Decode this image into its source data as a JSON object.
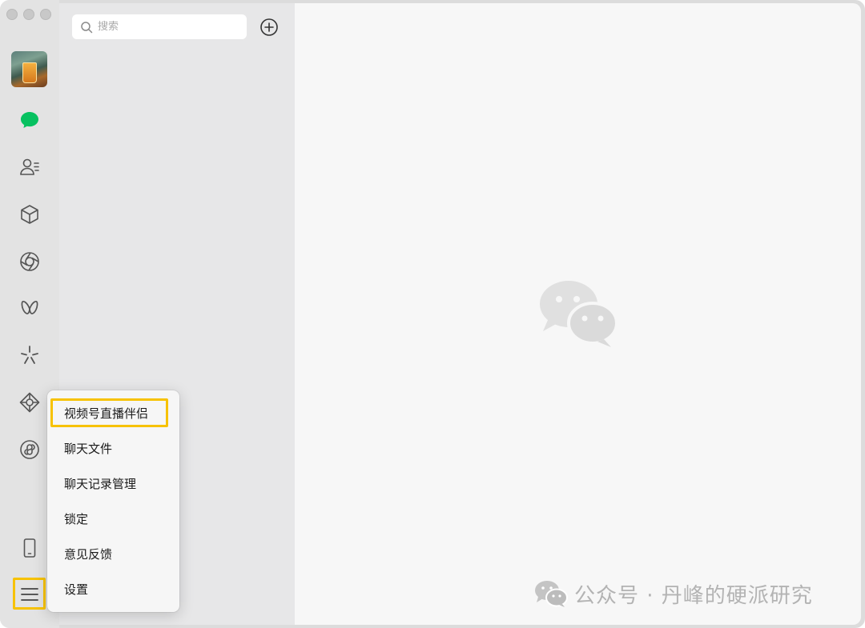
{
  "window": {
    "traffic_lights": [
      "close",
      "minimize",
      "zoom"
    ]
  },
  "sidebar": {
    "nav": [
      {
        "icon": "chat-bubble-icon",
        "label": "chats",
        "active": true
      },
      {
        "icon": "contacts-icon",
        "label": "contacts"
      },
      {
        "icon": "cube-icon",
        "label": "favorites"
      },
      {
        "icon": "moments-aperture-icon",
        "label": "moments"
      },
      {
        "icon": "channels-butterfly-icon",
        "label": "channels"
      },
      {
        "icon": "sparkle-icon",
        "label": "discover"
      },
      {
        "icon": "search-diamond-icon",
        "label": "search"
      },
      {
        "icon": "mini-program-icon",
        "label": "mini-programs"
      }
    ],
    "bottom": [
      {
        "icon": "phone-icon",
        "label": "phone"
      },
      {
        "icon": "hamburger-menu-icon",
        "label": "more"
      }
    ]
  },
  "list_pane": {
    "search": {
      "placeholder": "搜索",
      "value": ""
    },
    "add_icon": "plus-circle-icon"
  },
  "menu": {
    "items": [
      {
        "label": "视频号直播伴侣",
        "highlighted": true
      },
      {
        "label": "聊天文件"
      },
      {
        "label": "聊天记录管理"
      },
      {
        "label": "锁定"
      },
      {
        "label": "意见反馈"
      },
      {
        "label": "设置"
      }
    ]
  },
  "watermark": {
    "text": "公众号 · 丹峰的硬派研究",
    "icon": "wechat-logo-icon"
  },
  "colors": {
    "accent": "#07c160",
    "highlight_box": "#f7c200",
    "sidebar_bg": "#e3e3e3",
    "list_bg": "#e7e7e8",
    "main_bg": "#f7f7f7"
  }
}
